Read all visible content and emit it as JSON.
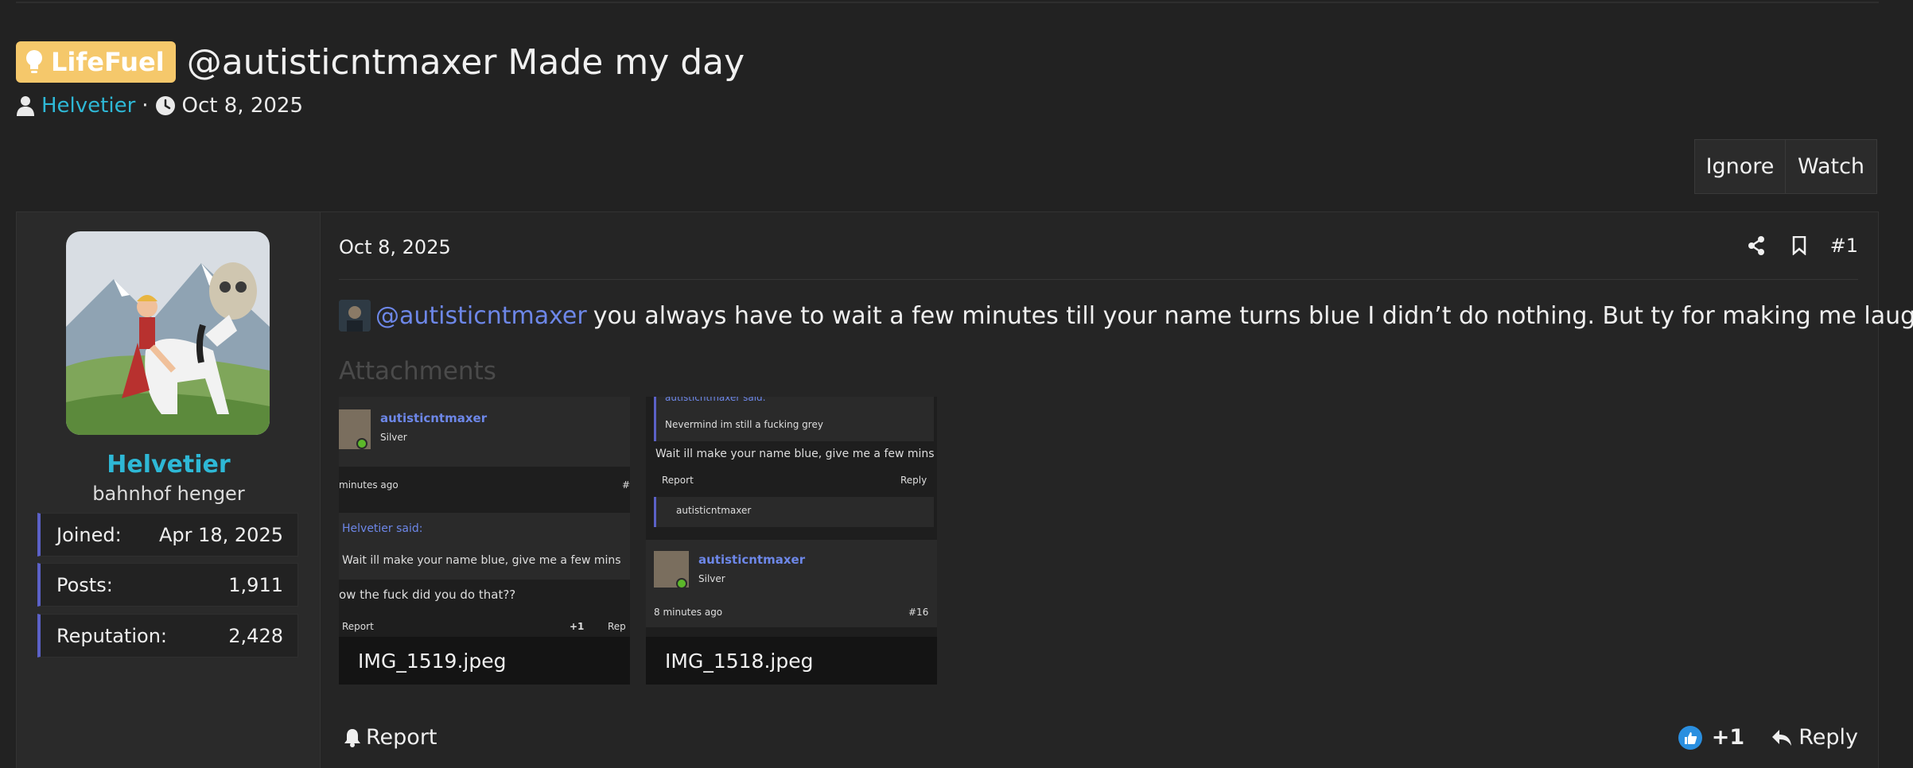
{
  "thread": {
    "prefix": "LifeFuel",
    "title": "@autisticntmaxer Made my day",
    "author": "Helvetier",
    "separator": "·",
    "date": "Oct 8, 2025",
    "buttons": {
      "ignore": "Ignore",
      "watch": "Watch"
    }
  },
  "user": {
    "name": "Helvetier",
    "title": "bahnhof henger",
    "stats": [
      {
        "label": "Joined:",
        "value": "Apr 18, 2025"
      },
      {
        "label": "Posts:",
        "value": "1,911"
      },
      {
        "label": "Reputation:",
        "value": "2,428"
      }
    ]
  },
  "post": {
    "date": "Oct 8, 2025",
    "number": "#1",
    "mention": "@autisticntmaxer",
    "message": "you always have to wait a few minutes till your name turns blue I didn’t do nothing. But ty for making me laugh",
    "attachments_label": "Attachments",
    "attachments": [
      {
        "caption": "IMG_1519.jpeg",
        "lines": {
          "user": "autisticntmaxer",
          "rank": "Silver",
          "time": "minutes ago",
          "quote_author": "Helvetier said:",
          "quote": "Wait ill make your name blue, give me a few mins",
          "reply": "ow the fuck did you do that??",
          "report": "Report",
          "like": "+1",
          "replyBtn": "Rep",
          "num": "#"
        }
      },
      {
        "caption": "IMG_1518.jpeg",
        "lines": {
          "said": "autisticntmaxer said:",
          "quote": "Nevermind im still a fucking grey",
          "text": "Wait ill make your name blue, give me a few mins",
          "report": "Report",
          "replyBtn": "Reply",
          "reactor": "autisticntmaxer",
          "user": "autisticntmaxer",
          "rank": "Silver",
          "time": "8 minutes ago",
          "num": "#16"
        }
      }
    ],
    "footer": {
      "report": "Report",
      "likes": "+1",
      "reply": "Reply"
    }
  },
  "colors": {
    "accent": "#2eb8d6",
    "mention": "#6d87e8",
    "prefix": "#f5c86b",
    "stat_border": "#5b61c7",
    "like": "#2a8fe0"
  }
}
